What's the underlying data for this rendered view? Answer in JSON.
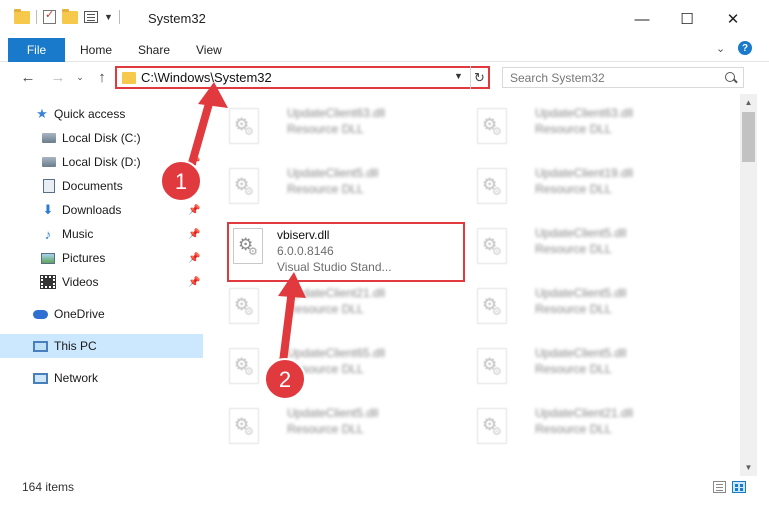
{
  "window": {
    "title": "System32",
    "minimize_glyph": "—",
    "maximize_glyph": "☐",
    "close_glyph": "✕"
  },
  "ribbon": {
    "file": "File",
    "home": "Home",
    "share": "Share",
    "view": "View",
    "help": "?"
  },
  "address": {
    "path": "C:\\Windows\\System32",
    "search_placeholder": "Search System32"
  },
  "sidebar": {
    "items": [
      {
        "label": "Quick access",
        "icon": "star-icon",
        "pinned": false
      },
      {
        "label": "Local Disk (C:)",
        "icon": "disk-icon",
        "pinned": false
      },
      {
        "label": "Local Disk (D:)",
        "icon": "disk-icon",
        "pinned": true
      },
      {
        "label": "Documents",
        "icon": "documents-icon",
        "pinned": true
      },
      {
        "label": "Downloads",
        "icon": "download-icon",
        "pinned": true
      },
      {
        "label": "Music",
        "icon": "music-icon",
        "pinned": true
      },
      {
        "label": "Pictures",
        "icon": "pictures-icon",
        "pinned": true
      },
      {
        "label": "Videos",
        "icon": "videos-icon",
        "pinned": true
      },
      {
        "label": "OneDrive",
        "icon": "onedrive-icon",
        "pinned": false
      },
      {
        "label": "This PC",
        "icon": "pc-icon",
        "pinned": false,
        "selected": true
      },
      {
        "label": "Network",
        "icon": "network-icon",
        "pinned": false
      }
    ]
  },
  "files": {
    "col1": [
      {
        "name": "UpdateClient63.dll",
        "type": "Resource DLL"
      },
      {
        "name": "UpdateClient5.dll",
        "type": "Resource DLL"
      },
      {
        "name": "vbiserv.dll",
        "version": "6.0.0.8146",
        "description": "Visual Studio Stand...",
        "highlighted": true
      },
      {
        "name": "UpdateClient21.dll",
        "type": "Resource DLL"
      },
      {
        "name": "UpdateClient65.dll",
        "type": "Resource DLL"
      },
      {
        "name": "UpdateClient5.dll",
        "type": "Resource DLL"
      }
    ],
    "col2": [
      {
        "name": "UpdateClient63.dll",
        "type": "Resource DLL"
      },
      {
        "name": "UpdateClient19.dll",
        "type": "Resource DLL"
      },
      {
        "name": "UpdateClient5.dll",
        "type": "Resource DLL"
      },
      {
        "name": "UpdateClient5.dll",
        "type": "Resource DLL"
      },
      {
        "name": "UpdateClient5.dll",
        "type": "Resource DLL"
      },
      {
        "name": "UpdateClient21.dll",
        "type": "Resource DLL"
      }
    ]
  },
  "status": {
    "item_count": "164 items"
  },
  "annotations": {
    "step1": "1",
    "step2": "2",
    "color": "#e0393e"
  }
}
